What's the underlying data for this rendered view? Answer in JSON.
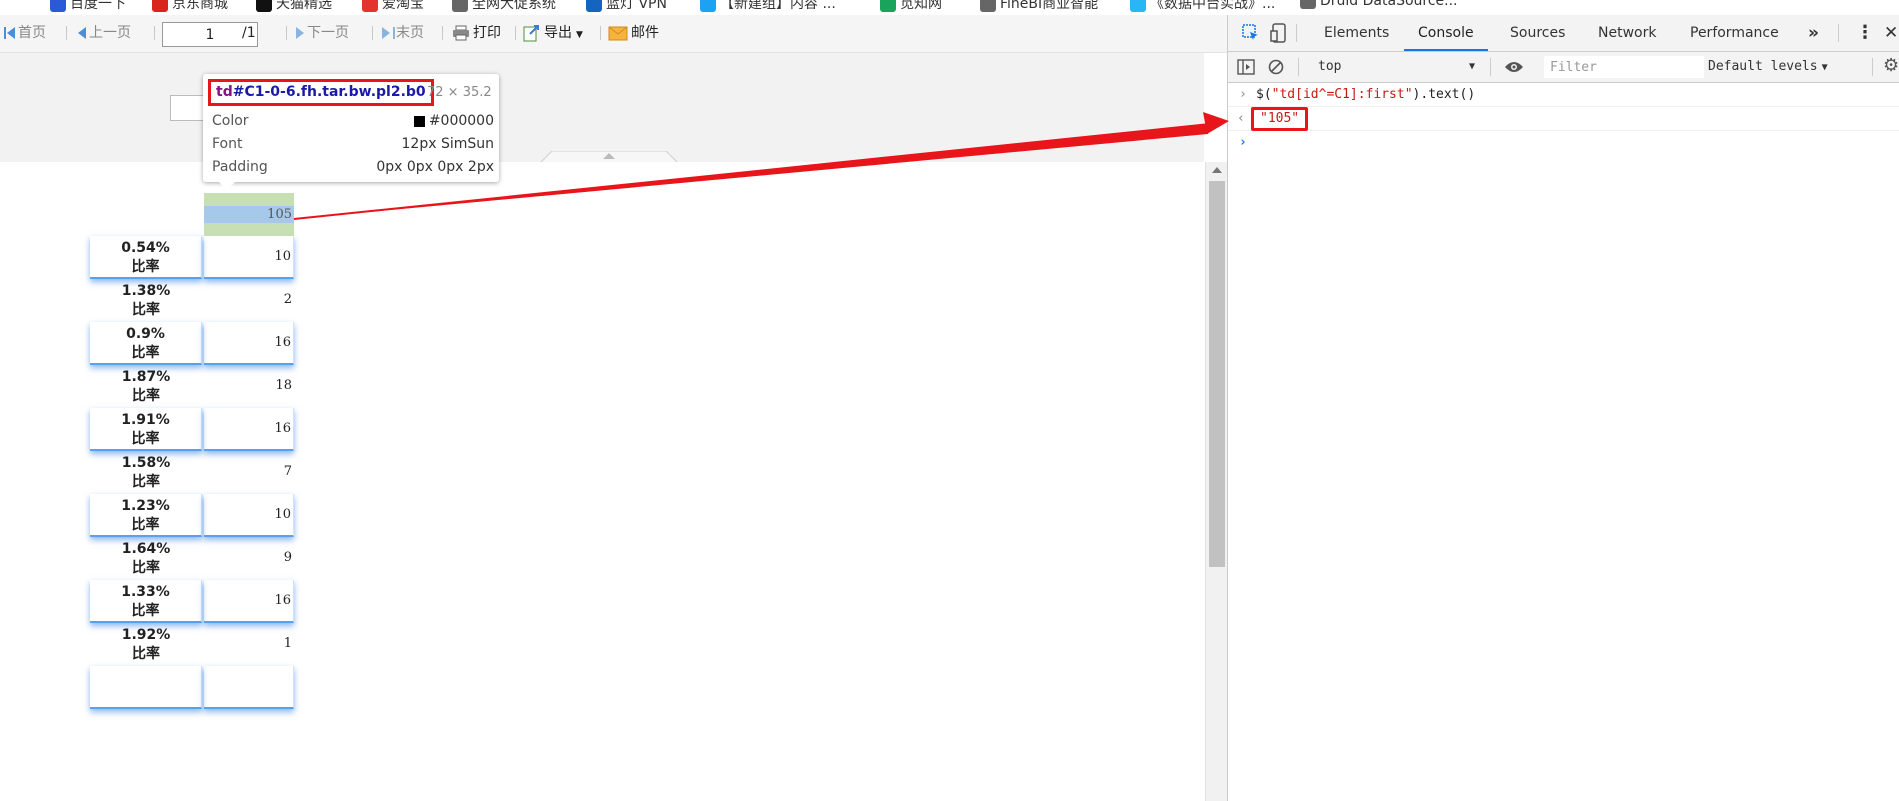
{
  "bookmarks": [
    {
      "label": "百度一下",
      "color": "#2a5bd7"
    },
    {
      "label": "京东商城",
      "color": "#d9261c"
    },
    {
      "label": "天猫精选",
      "color": "#111111"
    },
    {
      "label": "爱淘宝",
      "color": "#e4322d"
    },
    {
      "label": "全网大促系统",
      "color": "#666666"
    },
    {
      "label": "蓝灯 VPN",
      "color": "#1565c0"
    },
    {
      "label": "【新建组】内容 ...",
      "color": "#1da1f2"
    },
    {
      "label": "觅知网",
      "color": "#1aa35a"
    },
    {
      "label": "FineBI商业智能",
      "color": "#666666"
    },
    {
      "label": "《数据中台实战》...",
      "color": "#29b6f6"
    },
    {
      "label": "Druid DataSource...",
      "color": "#666666"
    }
  ],
  "toolbar": {
    "first": "首页",
    "prev": "上一页",
    "page_value": "1",
    "page_total": "/1",
    "next": "下一页",
    "last": "末页",
    "print": "打印",
    "export": "导出",
    "mail": "邮件"
  },
  "tooltip": {
    "selector_tag": "td",
    "selector_rest": "#C1-0-6.fh.tar.bw.pl2.b0",
    "size": "72 × 35.2",
    "rows": [
      {
        "key": "Color",
        "value": "#000000"
      },
      {
        "key": "Font",
        "value": "12px SimSun"
      },
      {
        "key": "Padding",
        "value": "0px 0px 0px 2px"
      }
    ],
    "swatch_color": "#000000"
  },
  "report": {
    "header_value": "105",
    "rows": [
      {
        "percent": "0.54%",
        "label": "比率",
        "value": "10",
        "highlighted": true
      },
      {
        "percent": "1.38%",
        "label": "比率",
        "value": "2",
        "highlighted": false
      },
      {
        "percent": "0.9%",
        "label": "比率",
        "value": "16",
        "highlighted": true
      },
      {
        "percent": "1.87%",
        "label": "比率",
        "value": "18",
        "highlighted": false
      },
      {
        "percent": "1.91%",
        "label": "比率",
        "value": "16",
        "highlighted": true
      },
      {
        "percent": "1.58%",
        "label": "比率",
        "value": "7",
        "highlighted": false
      },
      {
        "percent": "1.23%",
        "label": "比率",
        "value": "10",
        "highlighted": true
      },
      {
        "percent": "1.64%",
        "label": "比率",
        "value": "9",
        "highlighted": false
      },
      {
        "percent": "1.33%",
        "label": "比率",
        "value": "16",
        "highlighted": true
      },
      {
        "percent": "1.92%",
        "label": "比率",
        "value": "1",
        "highlighted": false
      },
      {
        "percent": "",
        "label": "",
        "value": "",
        "highlighted": true
      }
    ]
  },
  "devtools": {
    "tabs": [
      "Elements",
      "Console",
      "Sources",
      "Network",
      "Performance"
    ],
    "active_tab": "Console",
    "more_tabs": "»",
    "context": "top",
    "filter_placeholder": "Filter",
    "levels": "Default levels",
    "command_prefix": "$(",
    "command_string": "\"td[id^=C1]:first\"",
    "command_suffix": ").text()",
    "result": "\"105\""
  },
  "colors": {
    "annotation_red": "#e8151b",
    "header_green": "#c6e0b4",
    "cell_blue": "#a6c8ea",
    "devtools_accent": "#1a73e8"
  }
}
